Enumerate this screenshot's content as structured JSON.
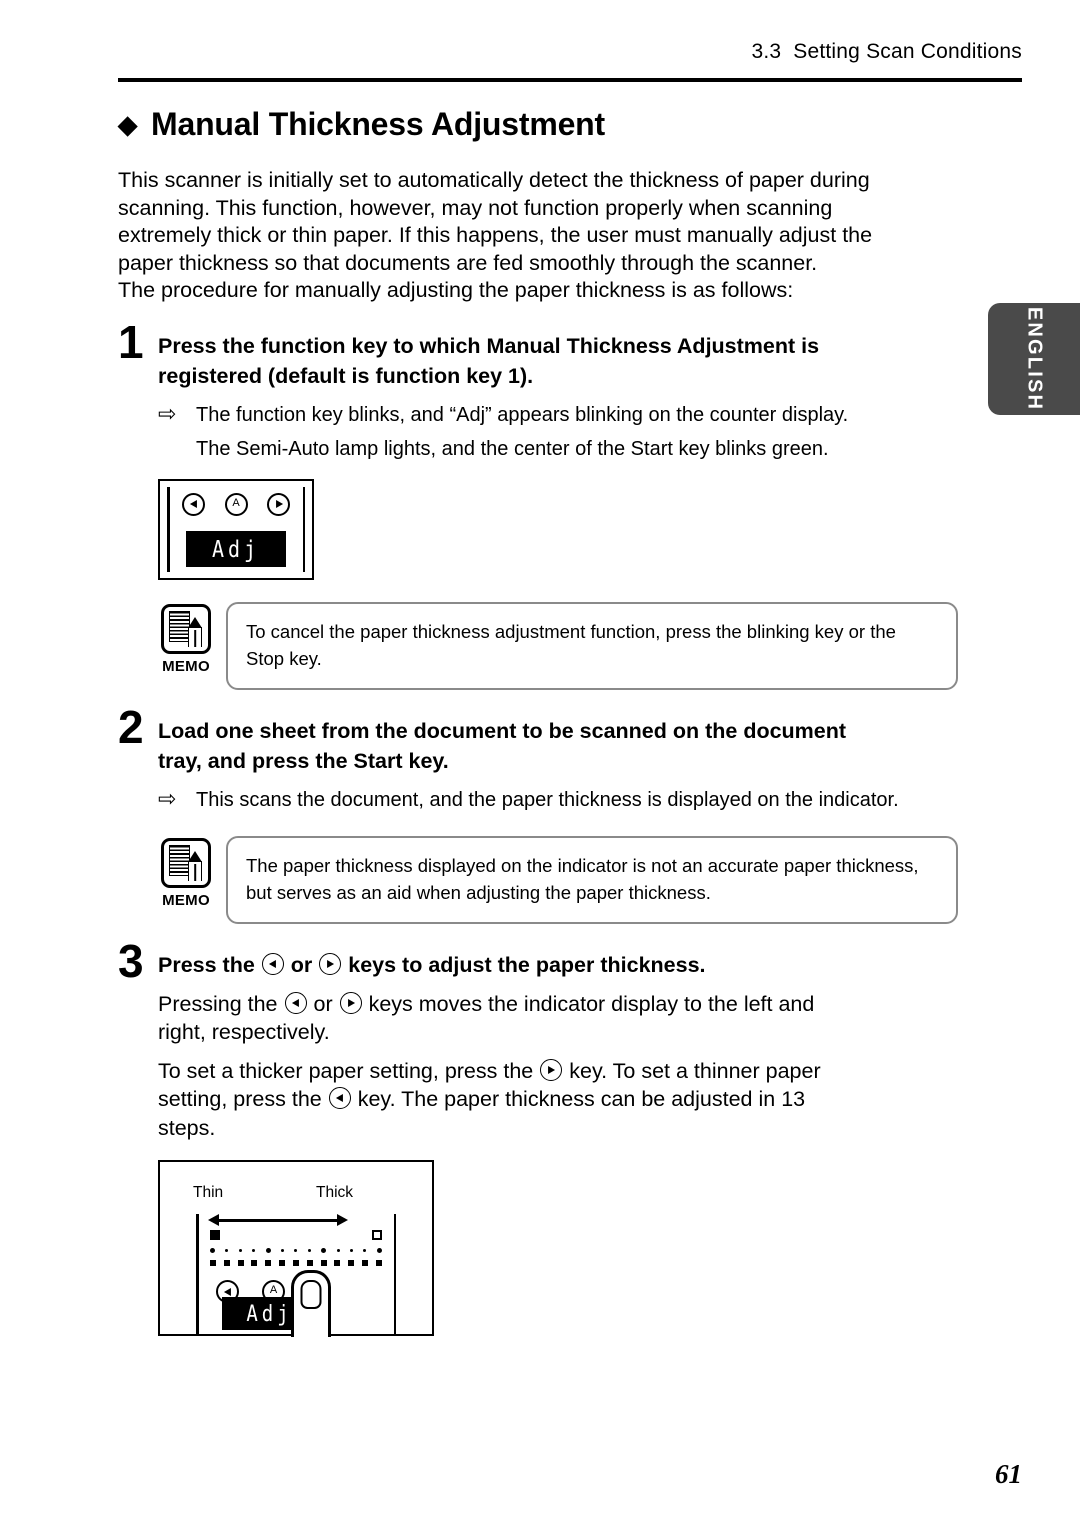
{
  "header": {
    "section_number": "3.3",
    "section_title": "Setting Scan Conditions"
  },
  "side_tab": {
    "label": "ENGLISH"
  },
  "page": {
    "number": "61",
    "heading_bullet": "◆",
    "heading": "Manual Thickness Adjustment"
  },
  "intro": {
    "line1": "This scanner is initially set to automatically detect the thickness of paper during",
    "line2": "scanning. This function, however, may not function properly when scanning",
    "line3": "extremely thick or thin paper. If this happens, the user must manually adjust the",
    "line4": "paper thickness so that documents are fed smoothly through the scanner.",
    "line5": "The procedure for manually adjusting the paper thickness is as follows:"
  },
  "steps": [
    {
      "number": "1",
      "title_line1": "Press the function key to which Manual Thickness Adjustment is",
      "title_line2": "registered (default is function key 1).",
      "result_arrow": "⇨",
      "result": "The function key blinks, and “Adj” appears blinking on the counter display.",
      "result_sub": "The Semi-Auto lamp lights, and the center of the Start key blinks green."
    },
    {
      "number": "2",
      "title_line1": "Load one sheet from the document to be scanned on the document",
      "title_line2": "tray, and press the Start key.",
      "result_arrow": "⇨",
      "result": "This scans the document, and the paper thickness is displayed on the indicator."
    },
    {
      "number": "3",
      "title_pre": "Press the",
      "title_mid": "or",
      "title_post": "keys to adjust the paper thickness.",
      "body": {
        "p1_pre": "Pressing the",
        "p1_mid": "or",
        "p1_post": "keys moves the indicator display to the left and",
        "p1_line2": "right, respectively.",
        "p2_pre": "To set a thicker paper setting, press the",
        "p2_mid": "key. To set a thinner paper",
        "p2_line2_pre": "setting, press the",
        "p2_line2_post": "key. The paper thickness can be adjusted in 13",
        "p2_line3": "steps."
      }
    }
  ],
  "memos": [
    {
      "icon": "memo-document-pencil-icon",
      "label": "MEMO",
      "line1": "To cancel the paper thickness adjustment function, press the blinking key or the",
      "line2": "Stop key."
    },
    {
      "icon": "memo-document-pencil-icon",
      "label": "MEMO",
      "line1": "The paper thickness displayed on the indicator is not an accurate paper thickness,",
      "line2": "but serves as an aid when adjusting the paper thickness."
    }
  ],
  "figures": {
    "control_panel": {
      "left_key": "left-arrow-key",
      "center_key": "A",
      "right_key": "right-arrow-key",
      "lcd_text": "Adj"
    },
    "thickness_panel": {
      "label_thin": "Thin",
      "label_thick": "Thick",
      "indicator_steps": 13,
      "marker_left": "filled-square",
      "marker_right": "hollow-square",
      "left_key": "left-arrow-key",
      "center_key": "A",
      "right_key": "right-arrow-key",
      "lcd_text": "Adj",
      "finger": "finger-pressing-right-key"
    }
  },
  "colors": {
    "ink": "#000000",
    "paper": "#ffffff",
    "tab_background": "#4a4a4a",
    "memo_border": "#8a8a8a"
  }
}
